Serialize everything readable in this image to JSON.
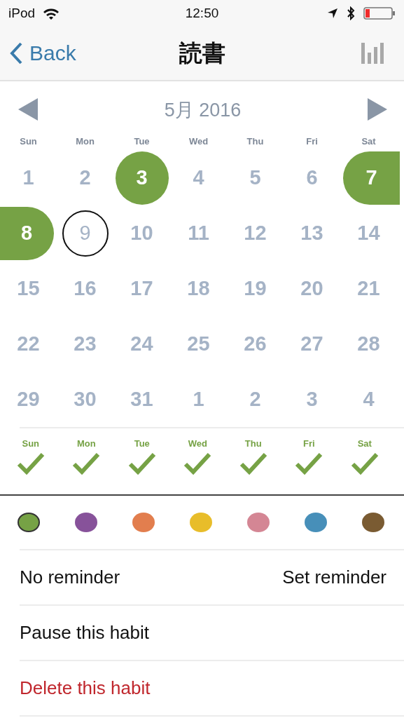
{
  "status_bar": {
    "carrier": "iPod",
    "time": "12:50"
  },
  "nav": {
    "back": "Back",
    "title": "読書"
  },
  "calendar": {
    "month": "5月 2016",
    "weekdays": [
      "Sun",
      "Mon",
      "Tue",
      "Wed",
      "Thu",
      "Fri",
      "Sat"
    ],
    "days": [
      {
        "label": "1",
        "done": false,
        "today": false
      },
      {
        "label": "2",
        "done": false,
        "today": false
      },
      {
        "label": "3",
        "done": true,
        "today": false
      },
      {
        "label": "4",
        "done": false,
        "today": false
      },
      {
        "label": "5",
        "done": false,
        "today": false
      },
      {
        "label": "6",
        "done": false,
        "today": false
      },
      {
        "label": "7",
        "done": true,
        "today": false
      },
      {
        "label": "8",
        "done": true,
        "today": false
      },
      {
        "label": "9",
        "done": false,
        "today": true
      },
      {
        "label": "10",
        "done": false,
        "today": false
      },
      {
        "label": "11",
        "done": false,
        "today": false
      },
      {
        "label": "12",
        "done": false,
        "today": false
      },
      {
        "label": "13",
        "done": false,
        "today": false
      },
      {
        "label": "14",
        "done": false,
        "today": false
      },
      {
        "label": "15",
        "done": false,
        "today": false
      },
      {
        "label": "16",
        "done": false,
        "today": false
      },
      {
        "label": "17",
        "done": false,
        "today": false
      },
      {
        "label": "18",
        "done": false,
        "today": false
      },
      {
        "label": "19",
        "done": false,
        "today": false
      },
      {
        "label": "20",
        "done": false,
        "today": false
      },
      {
        "label": "21",
        "done": false,
        "today": false
      },
      {
        "label": "22",
        "done": false,
        "today": false
      },
      {
        "label": "23",
        "done": false,
        "today": false
      },
      {
        "label": "24",
        "done": false,
        "today": false
      },
      {
        "label": "25",
        "done": false,
        "today": false
      },
      {
        "label": "26",
        "done": false,
        "today": false
      },
      {
        "label": "27",
        "done": false,
        "today": false
      },
      {
        "label": "28",
        "done": false,
        "today": false
      },
      {
        "label": "29",
        "done": false,
        "today": false
      },
      {
        "label": "30",
        "done": false,
        "today": false
      },
      {
        "label": "31",
        "done": false,
        "today": false
      },
      {
        "label": "1",
        "done": false,
        "today": false
      },
      {
        "label": "2",
        "done": false,
        "today": false
      },
      {
        "label": "3",
        "done": false,
        "today": false
      },
      {
        "label": "4",
        "done": false,
        "today": false
      }
    ]
  },
  "schedule": [
    {
      "label": "Sun",
      "checked": true
    },
    {
      "label": "Mon",
      "checked": true
    },
    {
      "label": "Tue",
      "checked": true
    },
    {
      "label": "Wed",
      "checked": true
    },
    {
      "label": "Thu",
      "checked": true
    },
    {
      "label": "Fri",
      "checked": true
    },
    {
      "label": "Sat",
      "checked": true
    }
  ],
  "colors": [
    {
      "color": "#76a245",
      "selected": true
    },
    {
      "color": "#87529a",
      "selected": false
    },
    {
      "color": "#e27e4e",
      "selected": false
    },
    {
      "color": "#e8bd2a",
      "selected": false
    },
    {
      "color": "#d48694",
      "selected": false
    },
    {
      "color": "#478fb9",
      "selected": false
    },
    {
      "color": "#7a5b32",
      "selected": false
    }
  ],
  "reminder": {
    "label": "No reminder",
    "action": "Set reminder"
  },
  "actions": [
    {
      "label": "Pause this habit",
      "kind": "normal"
    },
    {
      "label": "Delete this habit",
      "kind": "destructive"
    }
  ]
}
